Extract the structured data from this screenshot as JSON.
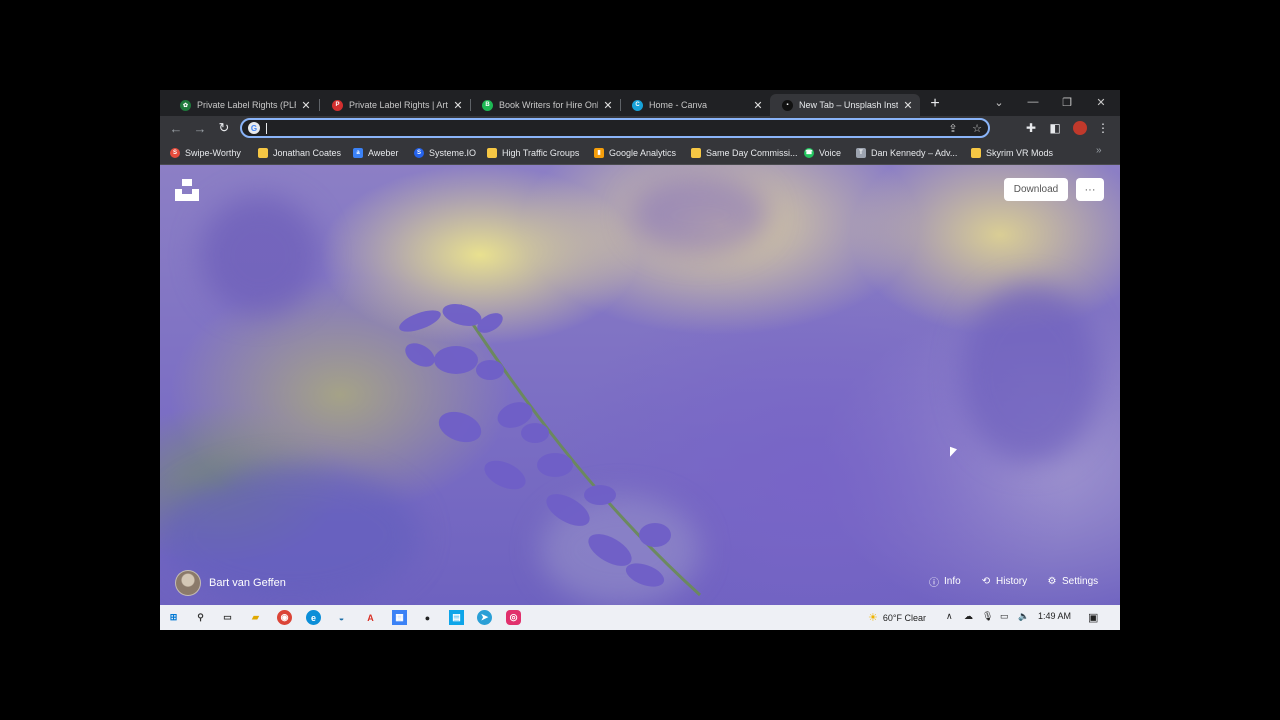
{
  "browser": {
    "tabs": [
      {
        "title": "Private Label Rights (PLR...",
        "icon": "plant-icon",
        "active": false
      },
      {
        "title": "Private Label Rights | Arti...",
        "icon": "plr-icon",
        "active": false
      },
      {
        "title": "Book Writers for Hire Onl...",
        "icon": "book-writers-icon",
        "active": false
      },
      {
        "title": "Home - Canva",
        "icon": "canva-icon",
        "active": false
      },
      {
        "title": "New Tab – Unsplash Insta...",
        "icon": "unsplash-icon",
        "active": true
      }
    ],
    "new_tab_label": "+",
    "omnibox": {
      "value": "",
      "placeholder": ""
    },
    "bookmarks": [
      {
        "label": "Swipe-Worthy",
        "icon": "swipe-icon",
        "color": "#e74c3c"
      },
      {
        "label": "Jonathan Coates",
        "icon": "folder-icon",
        "color": "#f6c744"
      },
      {
        "label": "Aweber",
        "icon": "aweber-icon",
        "color": "#3b82f6"
      },
      {
        "label": "Systeme.IO",
        "icon": "systeme-icon",
        "color": "#2563eb"
      },
      {
        "label": "High Traffic Groups",
        "icon": "folder-icon",
        "color": "#f6c744"
      },
      {
        "label": "Google Analytics",
        "icon": "analytics-icon",
        "color": "#f59e0b"
      },
      {
        "label": "Same Day Commissi...",
        "icon": "folder-icon",
        "color": "#f6c744"
      },
      {
        "label": "Voice",
        "icon": "voice-icon",
        "color": "#22c55e"
      },
      {
        "label": "Dan Kennedy – Adv...",
        "icon": "kennedy-icon",
        "color": "#9ca3af"
      },
      {
        "label": "Skyrim VR Mods",
        "icon": "folder-icon",
        "color": "#f6c744"
      }
    ]
  },
  "unsplash": {
    "download_label": "Download",
    "more_label": "···",
    "photographer": "Bart van Geffen",
    "footer": [
      {
        "label": "Info",
        "icon": "info-icon"
      },
      {
        "label": "History",
        "icon": "history-icon"
      },
      {
        "label": "Settings",
        "icon": "gear-icon"
      }
    ]
  },
  "taskbar": {
    "weather": "60°F  Clear",
    "time": "1:49 AM"
  },
  "colors": {
    "accent": "#8ab4f8",
    "toolbar": "#35363a",
    "tabstrip": "#202124"
  }
}
